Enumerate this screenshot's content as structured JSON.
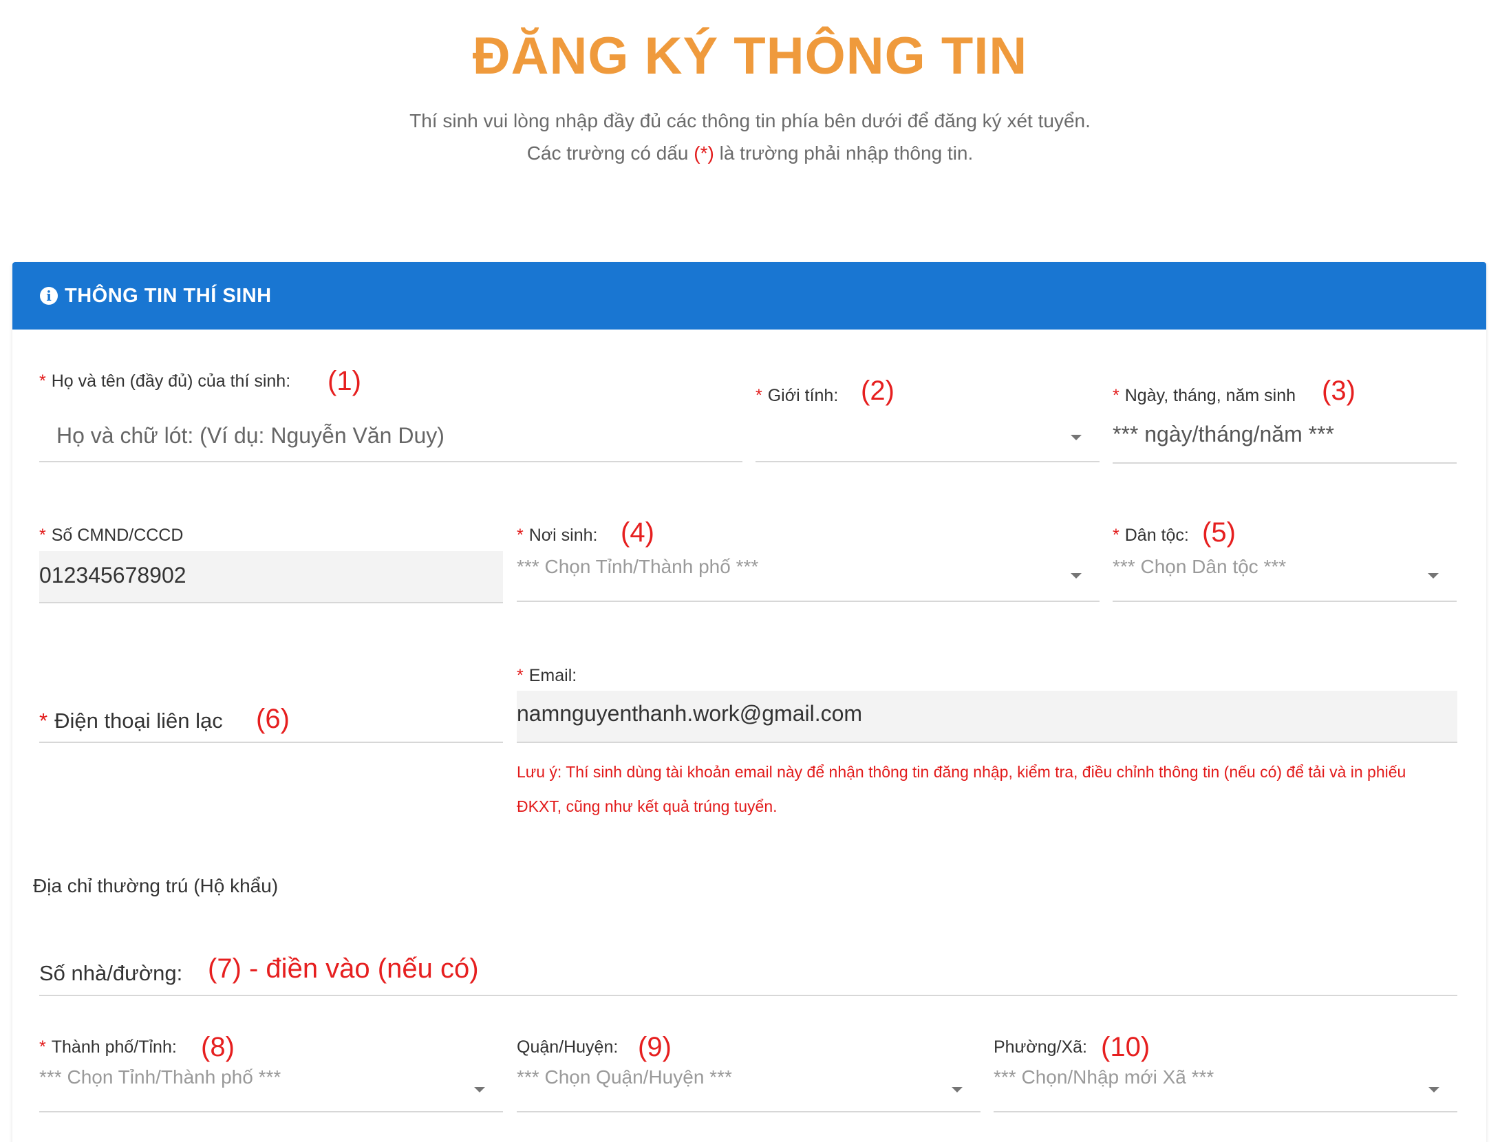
{
  "header": {
    "title": "ĐĂNG KÝ THÔNG TIN",
    "intro_line1": "Thí sinh vui lòng nhập đầy đủ các thông tin phía bên dưới để đăng ký xét tuyển.",
    "intro_line2_before": "Các trường có dấu ",
    "intro_line2_mark": "(*)",
    "intro_line2_after": " là trường phải nhập thông tin."
  },
  "card": {
    "icon": "info-icon",
    "title": "THÔNG TIN THÍ SINH"
  },
  "required_mark": "*",
  "fields": {
    "fullname": {
      "label": "Họ và tên (đầy đủ) của thí sinh:",
      "annotation": "(1)",
      "placeholder": "Họ và chữ lót: (Ví dụ: Nguyễn Văn Duy)"
    },
    "gender": {
      "label": "Giới tính:",
      "annotation": "(2)",
      "value": ""
    },
    "birthdate": {
      "label": "Ngày, tháng, năm sinh",
      "annotation": "(3)",
      "placeholder": "*** ngày/tháng/năm ***"
    },
    "id_number": {
      "label": "Số CMND/CCCD",
      "value": "012345678902"
    },
    "birthplace": {
      "label": "Nơi sinh:",
      "annotation": "(4)",
      "placeholder": "*** Chọn Tỉnh/Thành phố ***"
    },
    "ethnicity": {
      "label": "Dân tộc:",
      "annotation": "(5)",
      "placeholder": "*** Chọn Dân tộc ***"
    },
    "phone": {
      "label": "Điện thoại liên lạc",
      "annotation": "(6)"
    },
    "email": {
      "label": "Email:",
      "value": "namnguyenthanh.work@gmail.com",
      "note": "Lưu ý: Thí sinh dùng tài khoản email này để nhận thông tin đăng nhập, kiểm tra, điều chỉnh thông tin (nếu có) để tải và in phiếu ĐKXT, cũng như kết quả trúng tuyển."
    },
    "address_section": "Địa chỉ thường trú (Hộ khẩu)",
    "street": {
      "label": "Số nhà/đường:",
      "annotation": "(7) - điền vào (nếu có)"
    },
    "city": {
      "label": "Thành phố/Tỉnh:",
      "annotation": "(8)",
      "placeholder": "*** Chọn Tỉnh/Thành phố ***"
    },
    "district": {
      "label": "Quận/Huyện:",
      "annotation": "(9)",
      "placeholder": "*** Chọn Quận/Huyện ***"
    },
    "ward": {
      "label": "Phường/Xã:",
      "annotation": "(10)",
      "placeholder": "*** Chọn/Nhập mới Xã ***"
    }
  },
  "colors": {
    "title": "#ef9a3c",
    "header_bg": "#1976d2",
    "required": "#e21b1b",
    "annotation": "#e61f1f"
  }
}
